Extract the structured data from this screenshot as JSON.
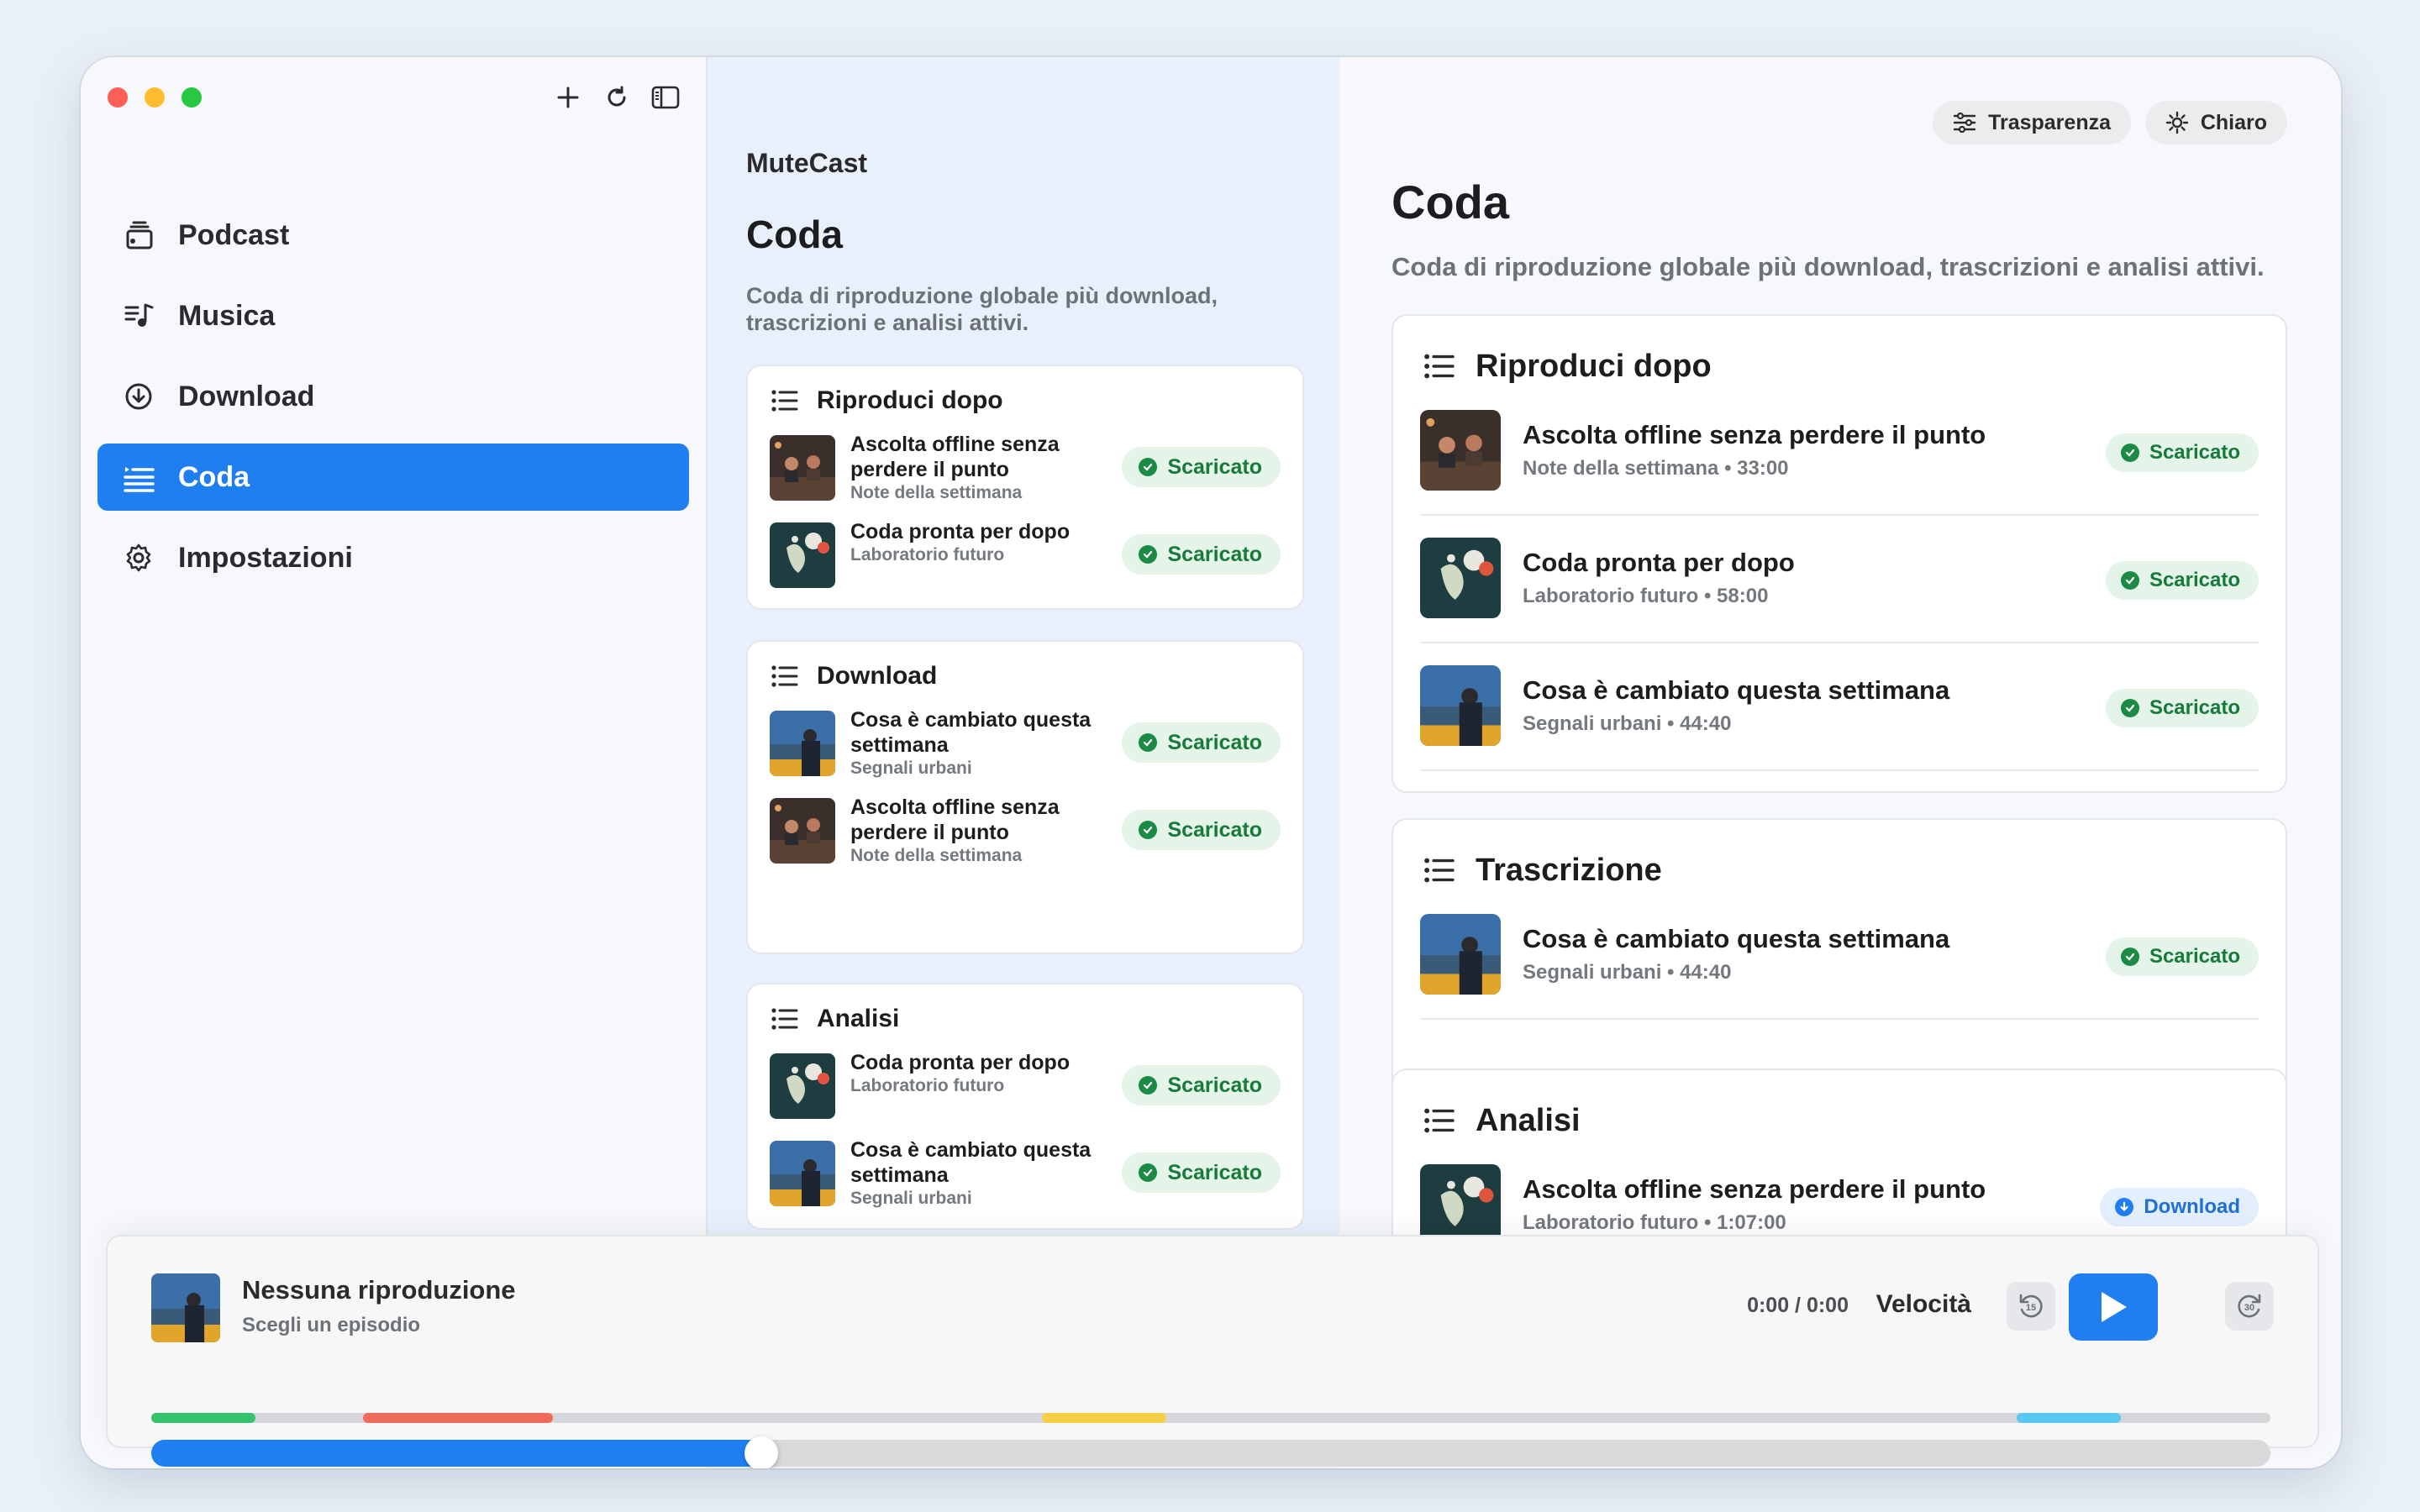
{
  "app": {
    "name": "MuteCast"
  },
  "sidebar": {
    "items": [
      {
        "label": "Podcast",
        "icon": "podcast-icon"
      },
      {
        "label": "Musica",
        "icon": "music-icon"
      },
      {
        "label": "Download",
        "icon": "download-icon"
      },
      {
        "label": "Coda",
        "icon": "queue-icon",
        "active": true
      },
      {
        "label": "Impostazioni",
        "icon": "gear-icon"
      }
    ]
  },
  "middle": {
    "title": "Coda",
    "subtitle": "Coda di riproduzione globale più download, trascrizioni e analisi attivi.",
    "sections": [
      {
        "title": "Riproduci dopo",
        "items": [
          {
            "title": "Ascolta offline senza perdere il punto",
            "show": "Note della settimana",
            "status": "Scaricato"
          },
          {
            "title": "Coda pronta per dopo",
            "show": "Laboratorio futuro",
            "status": "Scaricato"
          }
        ]
      },
      {
        "title": "Download",
        "items": [
          {
            "title": "Cosa è cambiato questa settimana",
            "show": "Segnali urbani",
            "status": "Scaricato"
          },
          {
            "title": "Ascolta offline senza perdere il punto",
            "show": "Note della settimana",
            "status": "Scaricato"
          }
        ]
      },
      {
        "title": "Analisi",
        "items": [
          {
            "title": "Coda pronta per dopo",
            "show": "Laboratorio futuro",
            "status": "Scaricato"
          },
          {
            "title": "Cosa è cambiato questa settimana",
            "show": "Segnali urbani",
            "status": "Scaricato"
          }
        ]
      }
    ]
  },
  "right": {
    "buttons": {
      "transparency": "Trasparenza",
      "theme": "Chiaro"
    },
    "title": "Coda",
    "subtitle": "Coda di riproduzione globale più download, trascrizioni e analisi attivi.",
    "sections": [
      {
        "title": "Riproduci dopo",
        "items": [
          {
            "title": "Ascolta offline senza perdere il punto",
            "meta": "Note della settimana • 33:00",
            "status": "Scaricato"
          },
          {
            "title": "Coda pronta per dopo",
            "meta": "Laboratorio futuro • 58:00",
            "status": "Scaricato"
          },
          {
            "title": "Cosa è cambiato questa settimana",
            "meta": "Segnali urbani • 44:40",
            "status": "Scaricato"
          }
        ]
      },
      {
        "title": "Trascrizione",
        "items": [
          {
            "title": "Cosa è cambiato questa settimana",
            "meta": "Segnali urbani • 44:40",
            "status": "Scaricato"
          }
        ]
      },
      {
        "title": "Analisi",
        "items": [
          {
            "title": "Ascolta offline senza perdere il punto",
            "meta": "Laboratorio futuro • 1:07:00",
            "status": "Download"
          }
        ]
      }
    ]
  },
  "player": {
    "title": "Nessuna riproduzione",
    "subtitle": "Scegli un episodio",
    "time": "0:00 / 0:00",
    "speed_label": "Velocità",
    "skip_back": "15",
    "skip_forward": "30",
    "progress": 0.28
  },
  "colors": {
    "accent": "#1f7ff0",
    "status_ok_bg": "#e4f4e8",
    "status_ok_fg": "#157a3a",
    "segments": [
      "#34c26a",
      "#ef6a5b",
      "#f7cf47",
      "#5ac8f5"
    ]
  }
}
